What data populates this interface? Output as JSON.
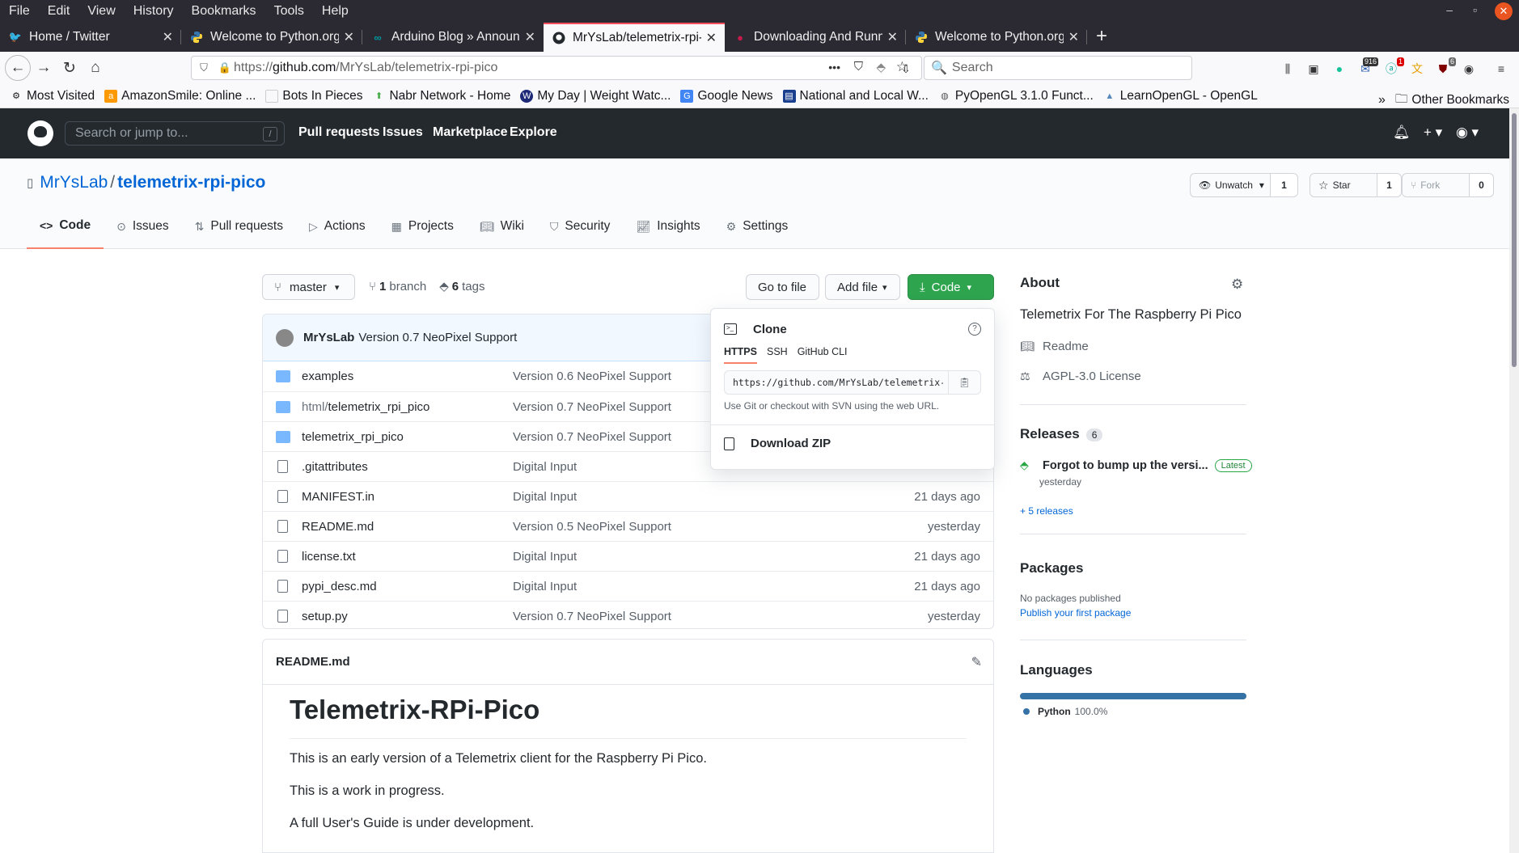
{
  "menubar": {
    "items": [
      "File",
      "Edit",
      "View",
      "History",
      "Bookmarks",
      "Tools",
      "Help"
    ],
    "min": "–",
    "max": "▫",
    "close": "✕"
  },
  "tabs": [
    {
      "title": "Home / Twitter",
      "icon": "twitter-icon",
      "color": "#1da1f2"
    },
    {
      "title": "Welcome to Python.org",
      "icon": "python-icon",
      "color": "#3776ab"
    },
    {
      "title": "Arduino Blog » Announc",
      "icon": "arduino-icon",
      "color": "#00979d"
    },
    {
      "title": "MrYsLab/telemetrix-rpi-p",
      "icon": "github-icon",
      "color": "#24292e"
    },
    {
      "title": "Downloading And Runnin",
      "icon": "rpi-icon",
      "color": "#c51a4a"
    },
    {
      "title": "Welcome to Python.org",
      "icon": "python-icon",
      "color": "#3776ab"
    }
  ],
  "tab_close": "✕",
  "new_tab": "+",
  "nav": {
    "url_proto": "https://",
    "url_host": "github.com",
    "url_path": "/MrYsLab/telemetrix-rpi-pico",
    "url_more": "•••",
    "search_placeholder": "Search",
    "badge_a": "916",
    "badge_b": "1",
    "badge_c": "6"
  },
  "bookmarks": [
    {
      "label": "Most Visited",
      "color": "#555"
    },
    {
      "label": "AmazonSmile: Online ...",
      "color": "#f90"
    },
    {
      "label": "Bots In Pieces",
      "color": "#eee"
    },
    {
      "label": "Nabr Network - Home",
      "color": "#4a4"
    },
    {
      "label": "My Day | Weight Watc...",
      "color": "#1e2a78"
    },
    {
      "label": "Google News",
      "color": "#4285f4"
    },
    {
      "label": "National and Local W...",
      "color": "#1b3f8f"
    },
    {
      "label": "PyOpenGL 3.1.0 Funct...",
      "color": "#777"
    },
    {
      "label": "LearnOpenGL - OpenGL",
      "color": "#5588bb"
    }
  ],
  "other_bookmarks": "Other Bookmarks",
  "gh": {
    "search_placeholder": "Search or jump to...",
    "slash": "/",
    "nav": [
      "Pull requests",
      "Issues",
      "Marketplace",
      "Explore"
    ],
    "owner": "MrYsLab",
    "sep": "/",
    "repo": "telemetrix-rpi-pico",
    "unwatch": "Unwatch",
    "unwatch_count": "1",
    "star": "Star",
    "star_count": "1",
    "fork": "Fork",
    "fork_count": "0",
    "tabs": [
      {
        "label": "Code",
        "icon": "code-icon"
      },
      {
        "label": "Issues",
        "icon": "issue-icon"
      },
      {
        "label": "Pull requests",
        "icon": "pull-request-icon"
      },
      {
        "label": "Actions",
        "icon": "play-icon"
      },
      {
        "label": "Projects",
        "icon": "project-icon"
      },
      {
        "label": "Wiki",
        "icon": "book-icon"
      },
      {
        "label": "Security",
        "icon": "shield-icon"
      },
      {
        "label": "Insights",
        "icon": "graph-icon"
      },
      {
        "label": "Settings",
        "icon": "gear-icon"
      }
    ],
    "branch": "master",
    "branch_count": "1",
    "branch_word": "branch",
    "tag_count": "6",
    "tag_word": "tags",
    "go_to_file": "Go to file",
    "add_file": "Add file",
    "code": "Code",
    "commit_author": "MrYsLab",
    "commit_msg": "Version 0.7 NeoPixel Support",
    "files": [
      {
        "type": "folder",
        "prefix": "",
        "name": "examples",
        "msg": "Version 0.6 NeoPixel Support",
        "time": ""
      },
      {
        "type": "folder",
        "prefix": "html/",
        "name": "telemetrix_rpi_pico",
        "msg": "Version 0.7 NeoPixel Support",
        "time": ""
      },
      {
        "type": "folder",
        "prefix": "",
        "name": "telemetrix_rpi_pico",
        "msg": "Version 0.7 NeoPixel Support",
        "time": ""
      },
      {
        "type": "file",
        "prefix": "",
        "name": ".gitattributes",
        "msg": "Digital Input",
        "time": ""
      },
      {
        "type": "file",
        "prefix": "",
        "name": "MANIFEST.in",
        "msg": "Digital Input",
        "time": "21 days ago"
      },
      {
        "type": "file",
        "prefix": "",
        "name": "README.md",
        "msg": "Version 0.5 NeoPixel Support",
        "time": "yesterday"
      },
      {
        "type": "file",
        "prefix": "",
        "name": "license.txt",
        "msg": "Digital Input",
        "time": "21 days ago"
      },
      {
        "type": "file",
        "prefix": "",
        "name": "pypi_desc.md",
        "msg": "Digital Input",
        "time": "21 days ago"
      },
      {
        "type": "file",
        "prefix": "",
        "name": "setup.py",
        "msg": "Version 0.7 NeoPixel Support",
        "time": "yesterday"
      }
    ],
    "clone": {
      "title": "Clone",
      "help": "?",
      "tabs": [
        "HTTPS",
        "SSH",
        "GitHub CLI"
      ],
      "url": "https://github.com/MrYsLab/telemetrix-rpi-pico.git",
      "note": "Use Git or checkout with SVN using the web URL.",
      "download": "Download ZIP"
    },
    "readme": {
      "file": "README.md",
      "h1": "Telemetrix-RPi-Pico",
      "p1": "This is an early version of a Telemetrix client for the Raspberry Pi Pico.",
      "p2": "This is a work in progress.",
      "p3": "A full User's Guide is under development."
    },
    "about": {
      "title": "About",
      "desc": "Telemetrix For The Raspberry Pi Pico",
      "readme": "Readme",
      "license": "AGPL-3.0 License"
    },
    "releases": {
      "title": "Releases",
      "count": "6",
      "latest_title": "Forgot to bump up the versi...",
      "latest_badge": "Latest",
      "latest_time": "yesterday",
      "more": "+ 5 releases"
    },
    "packages": {
      "title": "Packages",
      "none": "No packages published",
      "publish": "Publish your first package"
    },
    "languages": {
      "title": "Languages",
      "name": "Python",
      "pct": "100.0%",
      "color": "#3572a5"
    }
  }
}
